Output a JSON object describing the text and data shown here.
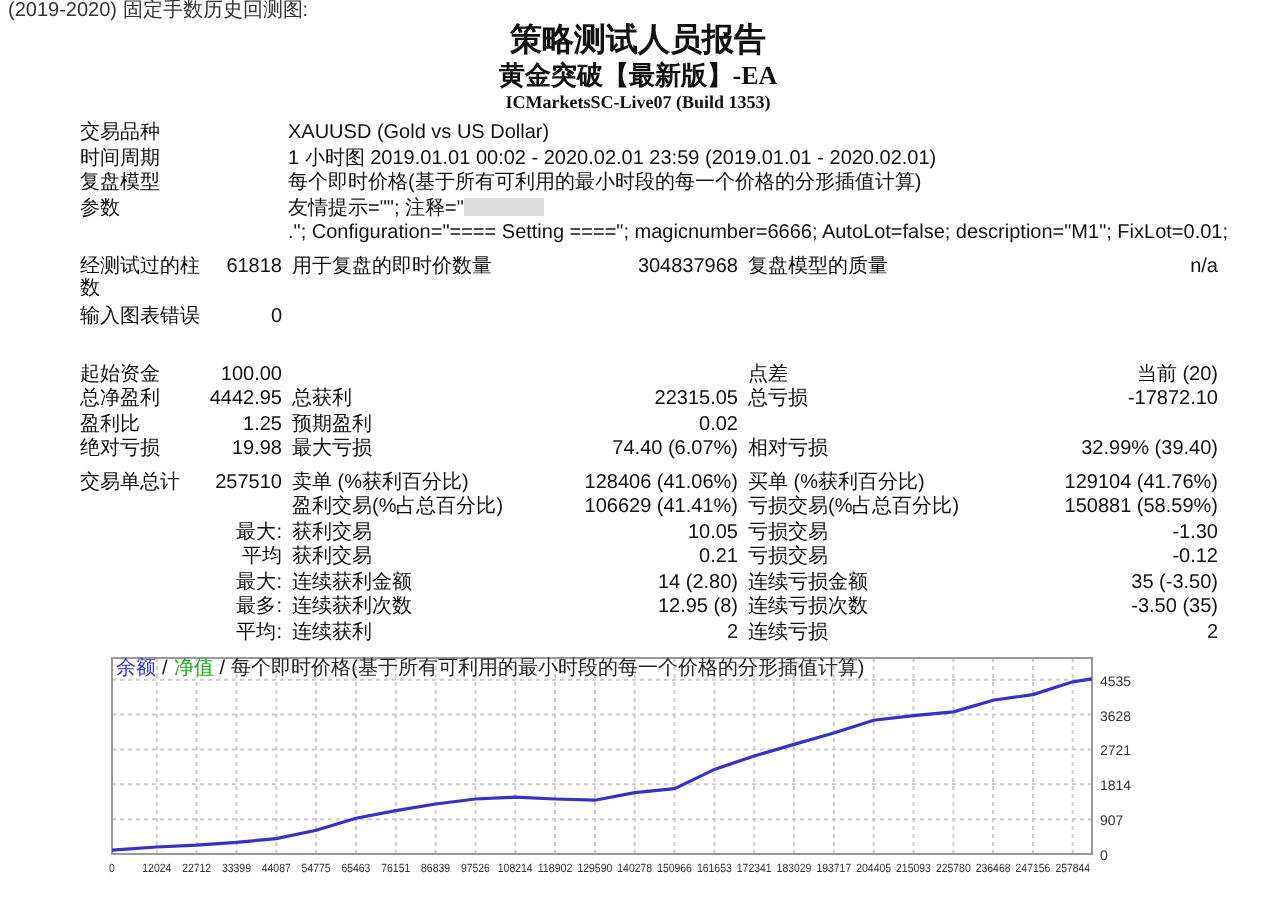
{
  "caption": "(2019-2020) 固定手数历史回测图:",
  "report": {
    "title": "策略测试人员报告",
    "subtitle": "黄金突破【最新版】-EA",
    "server": "ICMarketsSC-Live07 (Build 1353)"
  },
  "info": [
    {
      "label": "交易品种",
      "value": "XAUUSD (Gold vs US Dollar)"
    },
    {
      "label": "时间周期",
      "value": "1 小时图 2019.01.01 00:02 - 2020.02.01 23:59 (2019.01.01 - 2020.02.01)"
    },
    {
      "label": "复盘模型",
      "value": "每个即时价格(基于所有可利用的最小时段的每一个价格的分形插值计算)"
    },
    {
      "label": "参数",
      "value": "友情提示=\"\"; 注释=\"",
      "redacted": true,
      "value_after": ".\"; Configuration=\"==== Setting ====\"; magicnumber=6666; AutoLot=false; description=\"M1\"; FixLot=0.01;"
    }
  ],
  "sections": [
    {
      "rows": [
        {
          "label": "经测试过的柱数",
          "value": "61818",
          "label_2": "用于复盘的即时价数量",
          "value_2": "304837968",
          "label_3": "复盘模型的质量",
          "value_3": "n/a"
        },
        {
          "label": "输入图表错误",
          "value": "0"
        }
      ]
    },
    {
      "rows": [
        {
          "label": "起始资金",
          "value": "100.00",
          "label_3": "点差",
          "value_3": "当前 (20)"
        },
        {
          "label": "总净盈利",
          "value": "4442.95",
          "label_2": "总获利",
          "value_2": "22315.05",
          "label_3": "总亏损",
          "value_3": "-17872.10"
        },
        {
          "label": "盈利比",
          "value": "1.25",
          "label_2": "预期盈利",
          "value_2": "0.02"
        },
        {
          "label": "绝对亏损",
          "value": "19.98",
          "label_2": "最大亏损",
          "value_2": "74.40 (6.07%)",
          "label_3": "相对亏损",
          "value_3": "32.99% (39.40)"
        }
      ]
    },
    {
      "rows": [
        {
          "label": "交易单总计",
          "value": "257510",
          "label_2": "卖单 (%获利百分比)",
          "value_2": "128406 (41.06%)",
          "label_3": "买单 (%获利百分比)",
          "value_3": "129104 (41.76%)"
        },
        {
          "label_2": "盈利交易(%占总百分比)",
          "value_2": "106629 (41.41%)",
          "label_3": "亏损交易(%占总百分比)",
          "value_3": "150881 (58.59%)"
        },
        {
          "prefix": "最大:",
          "label_2": "获利交易",
          "value_2": "10.05",
          "label_3": "亏损交易",
          "value_3": "-1.30"
        },
        {
          "prefix": "平均",
          "label_2": "获利交易",
          "value_2": "0.21",
          "label_3": "亏损交易",
          "value_3": "-0.12"
        },
        {
          "prefix": "最大:",
          "label_2": "连续获利金额",
          "value_2": "14 (2.80)",
          "label_3": "连续亏损金额",
          "value_3": "35 (-3.50)"
        },
        {
          "prefix": "最多:",
          "label_2": "连续获利次数",
          "value_2": "12.95 (8)",
          "label_3": "连续亏损次数",
          "value_3": "-3.50 (35)"
        },
        {
          "prefix": "平均:",
          "label_2": "连续获利",
          "value_2": "2",
          "label_3": "连续亏损",
          "value_3": "2"
        }
      ]
    }
  ],
  "chart": {
    "legend": [
      {
        "kind": "series",
        "label": "余额",
        "color": "#3333cc"
      },
      {
        "kind": "separator",
        "label": "/"
      },
      {
        "kind": "series",
        "label": "净值",
        "color": "#22aa22"
      },
      {
        "kind": "separator",
        "label": "/"
      },
      {
        "kind": "series",
        "label": "每个即时价格(基于所有可利用的最小时段的每一个价格的分形插值计算)",
        "color": "#222222"
      }
    ],
    "chart_data": {
      "type": "line",
      "grid": true,
      "xlim": [
        0,
        263000
      ],
      "ylim": [
        0,
        5100
      ],
      "yticks": [
        0,
        907,
        1814,
        2721,
        3628,
        4535
      ],
      "xticks": [
        0,
        12024,
        22712,
        33399,
        44087,
        54775,
        65463,
        76151,
        86839,
        97526,
        108214,
        118902,
        129590,
        140278,
        150966,
        161653,
        172341,
        183029,
        193717,
        204405,
        215093,
        225780,
        236468,
        247156,
        257844
      ],
      "x": [
        0,
        12024,
        22712,
        33399,
        44087,
        54775,
        65463,
        76151,
        86839,
        97526,
        108214,
        118902,
        129590,
        140278,
        150966,
        161653,
        172341,
        183029,
        193717,
        204405,
        215093,
        225780,
        236468,
        247156,
        257844,
        263000
      ],
      "series": [
        {
          "color": "#3333cc",
          "values": [
            100,
            180,
            230,
            300,
            400,
            620,
            930,
            1130,
            1300,
            1430,
            1480,
            1430,
            1400,
            1600,
            1700,
            2200,
            2550,
            2850,
            3150,
            3480,
            3600,
            3700,
            4000,
            4150,
            4480,
            4560
          ]
        }
      ]
    }
  }
}
